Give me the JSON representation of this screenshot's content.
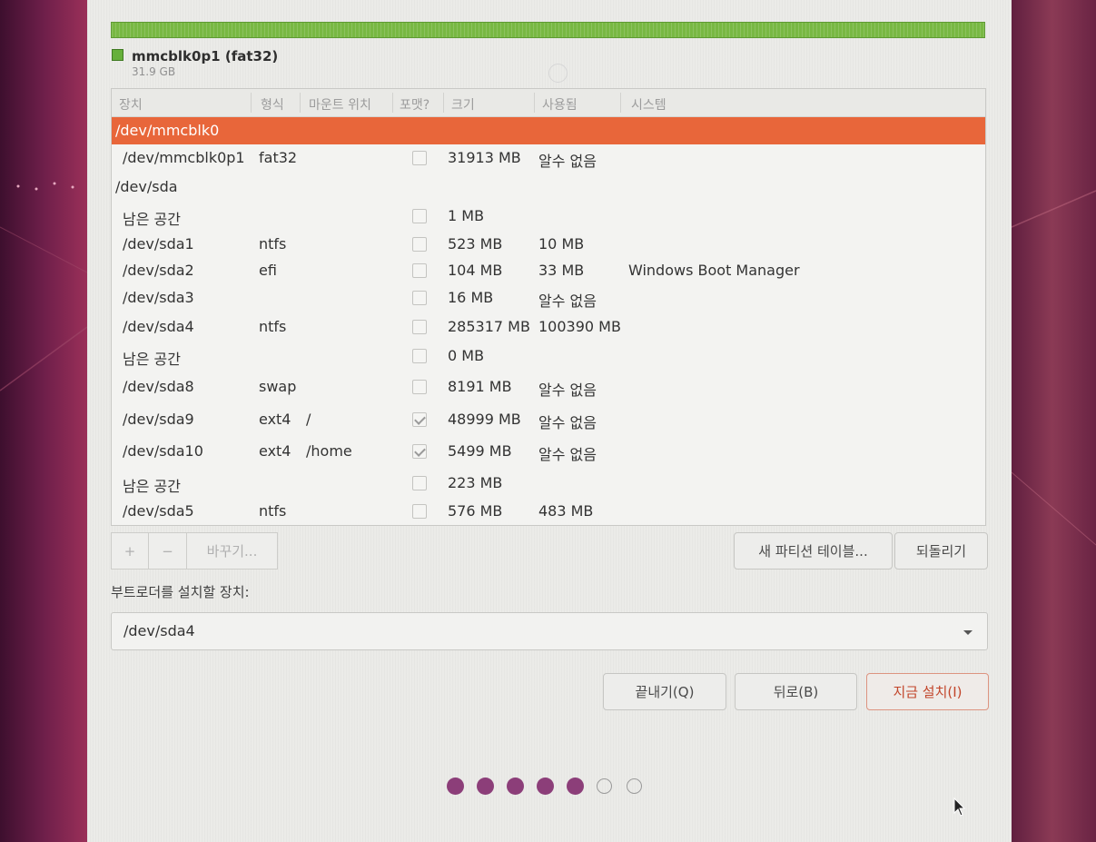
{
  "partition_bar": {
    "color": "#78b843",
    "legend_name": "mmcblk0p1 (fat32)",
    "legend_size": "31.9 GB"
  },
  "table": {
    "headers": [
      "장치",
      "형식",
      "마운트 위치",
      "포맷?",
      "크기",
      "사용됨",
      "시스템"
    ],
    "rows": [
      {
        "device": "/dev/mmcblk0",
        "type": "",
        "mount": "",
        "format": null,
        "size": "",
        "used": "",
        "system": "",
        "selected": true,
        "indent": false
      },
      {
        "device": "/dev/mmcblk0p1",
        "type": "fat32",
        "mount": "",
        "format": false,
        "size": "31913 MB",
        "used": "알수 없음",
        "system": "",
        "selected": false,
        "indent": true
      },
      {
        "device": "/dev/sda",
        "type": "",
        "mount": "",
        "format": null,
        "size": "",
        "used": "",
        "system": "",
        "selected": false,
        "indent": false
      },
      {
        "device": "남은 공간",
        "type": "",
        "mount": "",
        "format": false,
        "size": "1 MB",
        "used": "",
        "system": "",
        "selected": false,
        "indent": true
      },
      {
        "device": "/dev/sda1",
        "type": "ntfs",
        "mount": "",
        "format": false,
        "size": "523 MB",
        "used": "10 MB",
        "system": "",
        "selected": false,
        "indent": true
      },
      {
        "device": "/dev/sda2",
        "type": "efi",
        "mount": "",
        "format": false,
        "size": "104 MB",
        "used": "33 MB",
        "system": "Windows Boot Manager",
        "selected": false,
        "indent": true
      },
      {
        "device": "/dev/sda3",
        "type": "",
        "mount": "",
        "format": false,
        "size": "16 MB",
        "used": "알수 없음",
        "system": "",
        "selected": false,
        "indent": true
      },
      {
        "device": "/dev/sda4",
        "type": "ntfs",
        "mount": "",
        "format": false,
        "size": "285317 MB",
        "used": "100390 MB",
        "system": "",
        "selected": false,
        "indent": true
      },
      {
        "device": "남은 공간",
        "type": "",
        "mount": "",
        "format": false,
        "size": "0 MB",
        "used": "",
        "system": "",
        "selected": false,
        "indent": true
      },
      {
        "device": "/dev/sda8",
        "type": "swap",
        "mount": "",
        "format": false,
        "size": "8191 MB",
        "used": "알수 없음",
        "system": "",
        "selected": false,
        "indent": true
      },
      {
        "device": "/dev/sda9",
        "type": "ext4",
        "mount": "/",
        "format": true,
        "size": "48999 MB",
        "used": "알수 없음",
        "system": "",
        "selected": false,
        "indent": true
      },
      {
        "device": "/dev/sda10",
        "type": "ext4",
        "mount": "/home",
        "format": true,
        "size": "5499 MB",
        "used": "알수 없음",
        "system": "",
        "selected": false,
        "indent": true
      },
      {
        "device": "남은 공간",
        "type": "",
        "mount": "",
        "format": false,
        "size": "223 MB",
        "used": "",
        "system": "",
        "selected": false,
        "indent": true
      },
      {
        "device": "/dev/sda5",
        "type": "ntfs",
        "mount": "",
        "format": false,
        "size": "576 MB",
        "used": "483 MB",
        "system": "",
        "selected": false,
        "indent": true
      }
    ]
  },
  "toolbar": {
    "add_label": "+",
    "remove_label": "−",
    "change_label": "바꾸기..."
  },
  "buttons": {
    "new_table": "새 파티션 테이블...",
    "revert": "되돌리기",
    "quit": "끝내기(Q)",
    "back": "뒤로(B)",
    "install_now": "지금 설치(I)"
  },
  "bootloader": {
    "label": "부트로더를 설치할 장치:",
    "value": "/dev/sda4"
  },
  "progress": {
    "completed_steps": 5,
    "total_steps": 7,
    "filled_color": "#8c3e79"
  }
}
